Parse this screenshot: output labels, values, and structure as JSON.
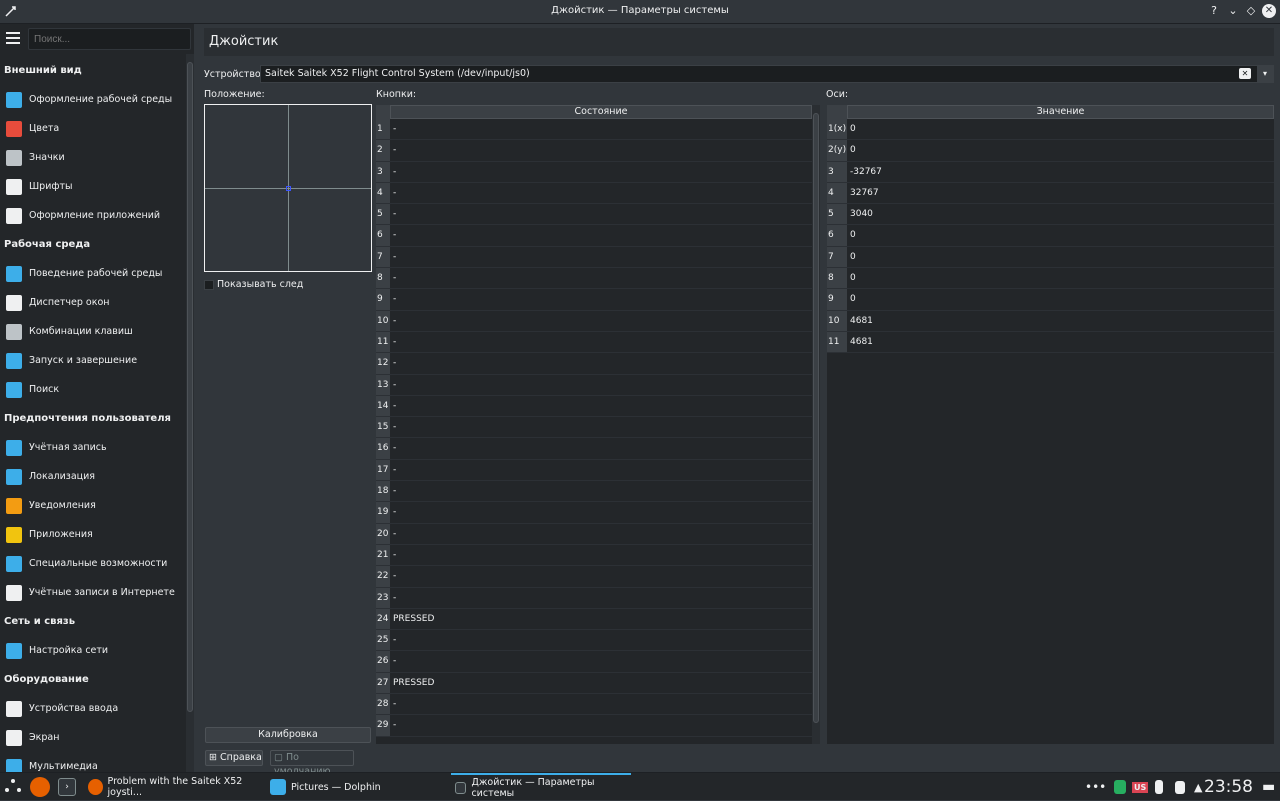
{
  "window": {
    "title": "Джойстик — Параметры системы",
    "controls": {
      "help": "?",
      "minimize": "⌄",
      "maximize": "◇",
      "close": "✕"
    }
  },
  "sidebar": {
    "search_placeholder": "Поиск...",
    "sections": [
      {
        "title": "Внешний вид",
        "items": [
          {
            "label": "Оформление рабочей среды",
            "icon": "workspace-theme-icon",
            "color": "#3daee9"
          },
          {
            "label": "Цвета",
            "icon": "colors-icon",
            "color": "#e74c3c"
          },
          {
            "label": "Значки",
            "icon": "icons-icon",
            "color": "#bdc3c7"
          },
          {
            "label": "Шрифты",
            "icon": "fonts-icon",
            "color": "#eff0f1"
          },
          {
            "label": "Оформление приложений",
            "icon": "app-style-icon",
            "color": "#eff0f1"
          }
        ]
      },
      {
        "title": "Рабочая среда",
        "items": [
          {
            "label": "Поведение рабочей среды",
            "icon": "desktop-behavior-icon",
            "color": "#3daee9"
          },
          {
            "label": "Диспетчер окон",
            "icon": "window-manager-icon",
            "color": "#eff0f1"
          },
          {
            "label": "Комбинации клавиш",
            "icon": "keyboard-icon",
            "color": "#bdc3c7"
          },
          {
            "label": "Запуск и завершение",
            "icon": "startup-icon",
            "color": "#3daee9"
          },
          {
            "label": "Поиск",
            "icon": "search-icon",
            "color": "#3daee9"
          }
        ]
      },
      {
        "title": "Предпочтения пользователя",
        "items": [
          {
            "label": "Учётная запись",
            "icon": "account-icon",
            "color": "#3daee9"
          },
          {
            "label": "Локализация",
            "icon": "locale-icon",
            "color": "#3daee9"
          },
          {
            "label": "Уведомления",
            "icon": "notifications-icon",
            "color": "#f39c12"
          },
          {
            "label": "Приложения",
            "icon": "applications-icon",
            "color": "#f1c40f"
          },
          {
            "label": "Специальные возможности",
            "icon": "accessibility-icon",
            "color": "#3daee9"
          },
          {
            "label": "Учётные записи в Интернете",
            "icon": "online-accounts-icon",
            "color": "#eff0f1"
          }
        ]
      },
      {
        "title": "Сеть и связь",
        "items": [
          {
            "label": "Настройка сети",
            "icon": "network-icon",
            "color": "#3daee9"
          }
        ]
      },
      {
        "title": "Оборудование",
        "items": [
          {
            "label": "Устройства ввода",
            "icon": "input-devices-icon",
            "color": "#eff0f1"
          },
          {
            "label": "Экран",
            "icon": "display-icon",
            "color": "#eff0f1"
          },
          {
            "label": "Мультимедиа",
            "icon": "multimedia-icon",
            "color": "#3daee9"
          }
        ]
      }
    ]
  },
  "main": {
    "title": "Джойстик",
    "device_label": "Устройство:",
    "device_value": "Saitek Saitek X52 Flight Control System (/dev/input/js0)",
    "position_label": "Положение:",
    "show_trace_label": "Показывать след",
    "calibrate_label": "Калибровка",
    "help_label": "Справка",
    "defaults_label": "По умолчанию",
    "buttons_label": "Кнопки:",
    "buttons_header": "Состояние",
    "buttons": [
      {
        "n": "1",
        "v": "-"
      },
      {
        "n": "2",
        "v": "-"
      },
      {
        "n": "3",
        "v": "-"
      },
      {
        "n": "4",
        "v": "-"
      },
      {
        "n": "5",
        "v": "-"
      },
      {
        "n": "6",
        "v": "-"
      },
      {
        "n": "7",
        "v": "-"
      },
      {
        "n": "8",
        "v": "-"
      },
      {
        "n": "9",
        "v": "-"
      },
      {
        "n": "10",
        "v": "-"
      },
      {
        "n": "11",
        "v": "-"
      },
      {
        "n": "12",
        "v": "-"
      },
      {
        "n": "13",
        "v": "-"
      },
      {
        "n": "14",
        "v": "-"
      },
      {
        "n": "15",
        "v": "-"
      },
      {
        "n": "16",
        "v": "-"
      },
      {
        "n": "17",
        "v": "-"
      },
      {
        "n": "18",
        "v": "-"
      },
      {
        "n": "19",
        "v": "-"
      },
      {
        "n": "20",
        "v": "-"
      },
      {
        "n": "21",
        "v": "-"
      },
      {
        "n": "22",
        "v": "-"
      },
      {
        "n": "23",
        "v": "-"
      },
      {
        "n": "24",
        "v": "PRESSED"
      },
      {
        "n": "25",
        "v": "-"
      },
      {
        "n": "26",
        "v": "-"
      },
      {
        "n": "27",
        "v": "PRESSED"
      },
      {
        "n": "28",
        "v": "-"
      },
      {
        "n": "29",
        "v": "-"
      }
    ],
    "axes_label": "Оси:",
    "axes_header": "Значение",
    "axes": [
      {
        "n": "1(x)",
        "v": "0"
      },
      {
        "n": "2(y)",
        "v": "0"
      },
      {
        "n": "3",
        "v": "-32767"
      },
      {
        "n": "4",
        "v": "32767"
      },
      {
        "n": "5",
        "v": "3040"
      },
      {
        "n": "6",
        "v": "0"
      },
      {
        "n": "7",
        "v": "0"
      },
      {
        "n": "8",
        "v": "0"
      },
      {
        "n": "9",
        "v": "0"
      },
      {
        "n": "10",
        "v": "4681"
      },
      {
        "n": "11",
        "v": "4681"
      }
    ]
  },
  "taskbar": {
    "tasks": [
      {
        "label": "Problem with the Saitek X52 joysti...",
        "icon": "firefox-icon"
      },
      {
        "label": "Pictures — Dolphin",
        "icon": "dolphin-icon"
      },
      {
        "label": "Джойстик — Параметры системы",
        "icon": "joystick-icon"
      }
    ],
    "clock": "23:58",
    "keyboard_layout": "US"
  }
}
